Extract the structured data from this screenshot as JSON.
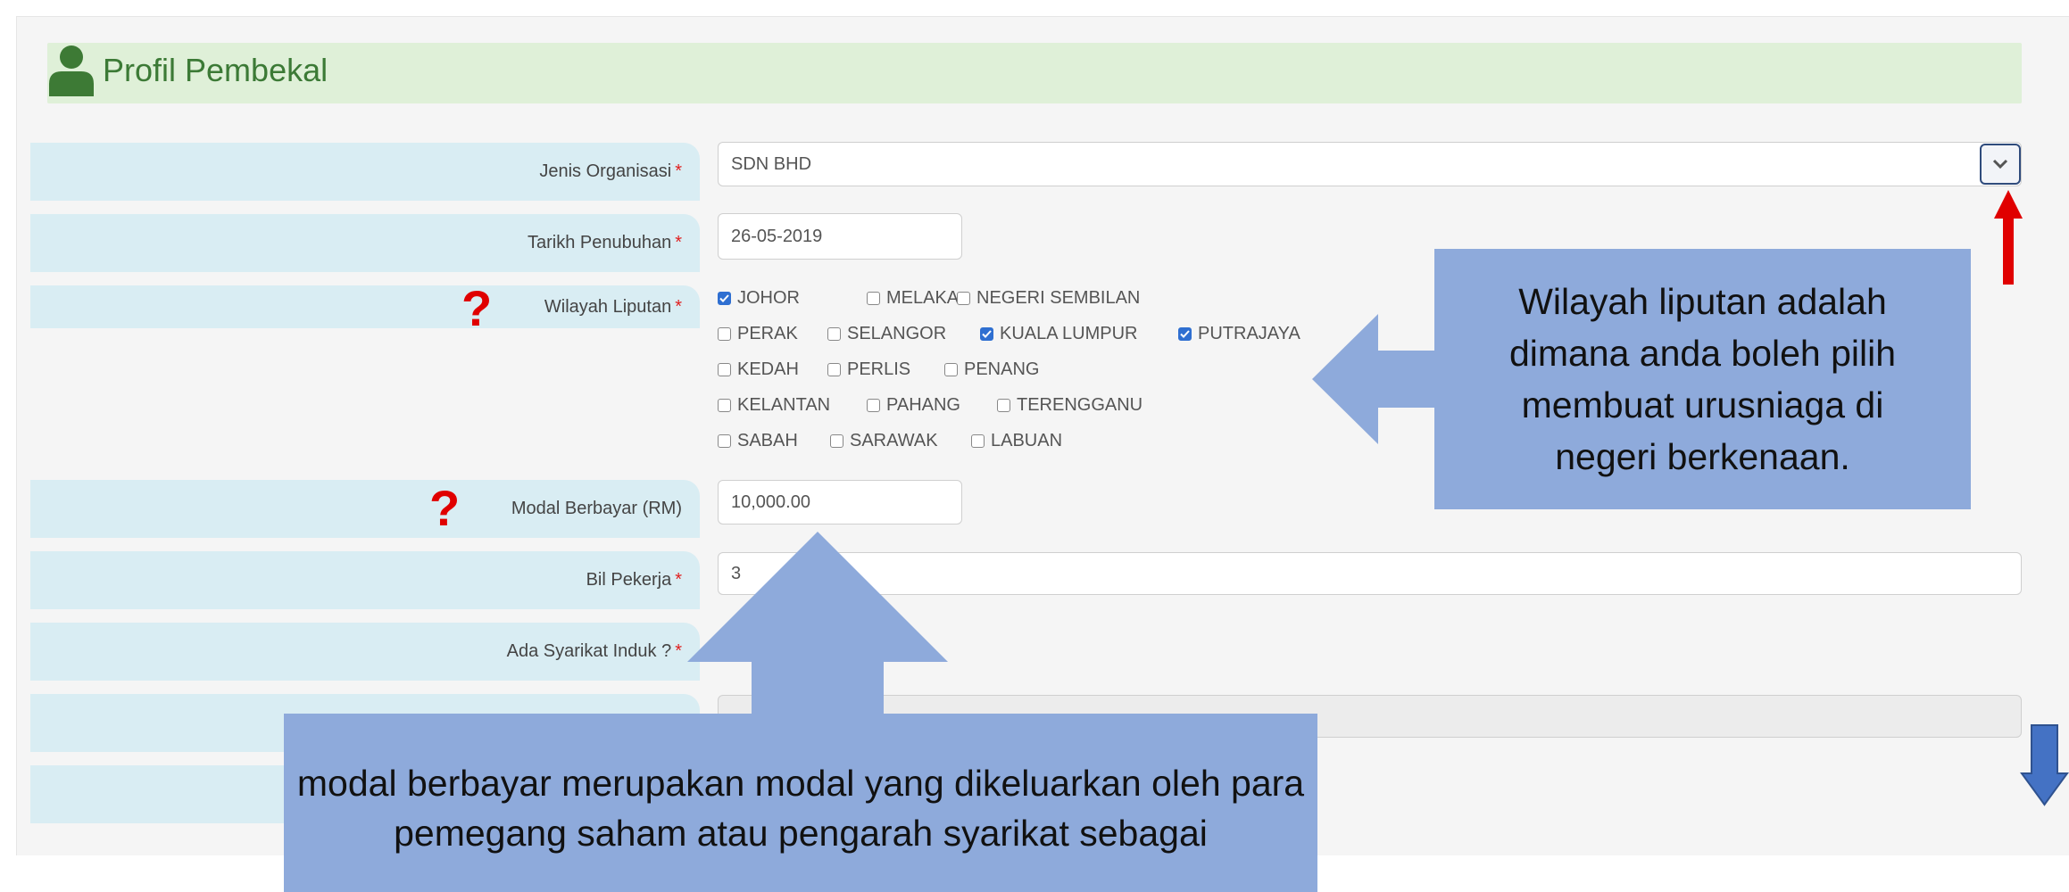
{
  "header": {
    "title": "Profil Pembekal",
    "icon": "user-icon"
  },
  "fields": {
    "jenis_organisasi": {
      "label": "Jenis Organisasi",
      "value": "SDN BHD"
    },
    "tarikh_penubuhan": {
      "label": "Tarikh Penubuhan",
      "value": "26-05-2019"
    },
    "wilayah_liputan": {
      "label": "Wilayah Liputan"
    },
    "modal_berbayar": {
      "label": "Modal Berbayar (RM)",
      "value": "10,000.00"
    },
    "bil_pekerja": {
      "label": "Bil Pekerja",
      "value": "3"
    },
    "syarikat_induk": {
      "label": "Ada Syarikat Induk ?"
    }
  },
  "required_mark": "*",
  "help_mark": "?",
  "states": [
    {
      "name": "JOHOR",
      "checked": true
    },
    {
      "name": "MELAKA",
      "checked": false
    },
    {
      "name": "NEGERI SEMBILAN",
      "checked": false
    },
    {
      "name": "PERAK",
      "checked": false
    },
    {
      "name": "SELANGOR",
      "checked": false
    },
    {
      "name": "KUALA LUMPUR",
      "checked": true
    },
    {
      "name": "PUTRAJAYA",
      "checked": true
    },
    {
      "name": "KEDAH",
      "checked": false
    },
    {
      "name": "PERLIS",
      "checked": false
    },
    {
      "name": "PENANG",
      "checked": false
    },
    {
      "name": "KELANTAN",
      "checked": false
    },
    {
      "name": "PAHANG",
      "checked": false
    },
    {
      "name": "TERENGGANU",
      "checked": false
    },
    {
      "name": "SABAH",
      "checked": false
    },
    {
      "name": "SARAWAK",
      "checked": false
    },
    {
      "name": "LABUAN",
      "checked": false
    }
  ],
  "callouts": {
    "wilayah": "Wilayah liputan adalah dimana anda boleh pilih membuat urusniaga di negeri berkenaan.",
    "modal": "modal berbayar merupakan modal yang dikeluarkan oleh para pemegang saham atau pengarah syarikat sebagai"
  },
  "colors": {
    "header_bg": "#dff0d8",
    "label_bg": "#d9edf3",
    "callout_bg": "#8eaadb",
    "checkbox_checked": "#2f6fd1",
    "required": "#e02020",
    "arrow_red": "#e00000",
    "arrow_blue": "#4472c4"
  }
}
